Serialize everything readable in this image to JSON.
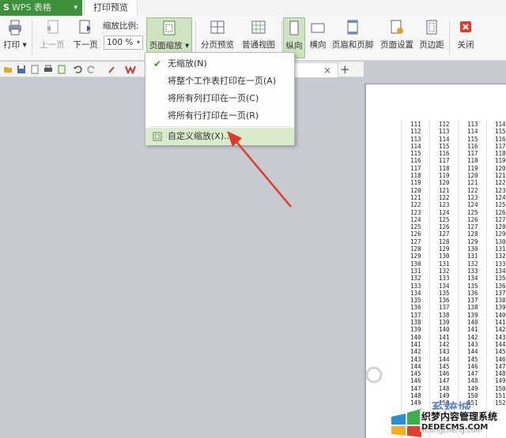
{
  "titlebar": {
    "app_logo": "S",
    "app_name": "WPS 表格",
    "app_dropdown": "▾",
    "active_tab": "打印预览"
  },
  "ribbon": {
    "print": "打印",
    "prev_page": "上一页",
    "next_page": "下一页",
    "scale_label": "缩放比例:",
    "scale_value": "100 %",
    "page_scaling": "页面缩放",
    "page_break_preview": "分页预览",
    "normal_view": "普通视图",
    "portrait": "纵向",
    "landscape": "横向",
    "header_footer": "页眉和页脚",
    "page_setup": "页面设置",
    "margins": "页边距",
    "close": "关闭"
  },
  "doc_tab": {
    "close": "×",
    "new_tab": "+"
  },
  "scale_menu": {
    "items": [
      {
        "label": "无缩放(N)",
        "checked": true
      },
      {
        "label": "将整个工作表打印在一页(A)"
      },
      {
        "label": "将所有列打印在一页(C)"
      },
      {
        "label": "将所有行打印在一页(R)"
      },
      {
        "label": "自定义缩放(X)..."
      }
    ]
  },
  "preview": {
    "columns": [
      [
        "111",
        "112",
        "113",
        "114",
        "115",
        "116",
        "117",
        "118",
        "119",
        "120",
        "121",
        "122",
        "123",
        "124",
        "125",
        "126",
        "127",
        "128",
        "129",
        "130",
        "131",
        "132",
        "133",
        "134",
        "135",
        "136",
        "137",
        "138",
        "139",
        "140",
        "141",
        "142",
        "143",
        "144",
        "145",
        "146",
        "147",
        "148",
        "149"
      ],
      [
        "112",
        "113",
        "114",
        "115",
        "116",
        "117",
        "118",
        "119",
        "120",
        "121",
        "122",
        "123",
        "124",
        "125",
        "126",
        "127",
        "128",
        "129",
        "130",
        "131",
        "132",
        "133",
        "134",
        "135",
        "136",
        "137",
        "138",
        "139",
        "140",
        "141",
        "142",
        "143",
        "144",
        "145",
        "146",
        "147",
        "148",
        "149",
        "150"
      ],
      [
        "113",
        "114",
        "115",
        "116",
        "117",
        "118",
        "119",
        "120",
        "121",
        "122",
        "123",
        "124",
        "125",
        "126",
        "127",
        "128",
        "129",
        "130",
        "131",
        "132",
        "133",
        "134",
        "135",
        "136",
        "137",
        "138",
        "139",
        "140",
        "141",
        "142",
        "143",
        "144",
        "145",
        "146",
        "147",
        "148",
        "149",
        "150",
        "151"
      ],
      [
        "114",
        "115",
        "116",
        "117",
        "118",
        "119",
        "120",
        "121",
        "122",
        "123",
        "124",
        "125",
        "126",
        "127",
        "128",
        "129",
        "130",
        "131",
        "132",
        "133",
        "134",
        "135",
        "136",
        "137",
        "138",
        "139",
        "140",
        "141",
        "142",
        "143",
        "144",
        "145",
        "146",
        "147",
        "148",
        "149",
        "150",
        "151",
        "152"
      ]
    ]
  },
  "watermark": {
    "brand": "织梦内容管理系统",
    "url": "DEDECMS.COM",
    "xt": "系统城",
    "site": "xitongcheng.com"
  },
  "colors": {
    "app_green": "#3f8f3c",
    "active_button": "#cfe3c2",
    "menu_highlight": "#d9ebcc",
    "arrow_red": "#e03a2f",
    "workspace": "#c7cad1"
  }
}
